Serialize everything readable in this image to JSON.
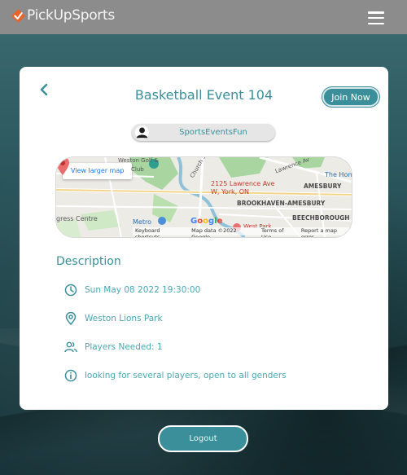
{
  "nav": {
    "brand": "PickUpSports",
    "menu_icon": "hamburger-menu-icon"
  },
  "event": {
    "title": "Basketball Event 104",
    "join_label": "Join Now",
    "host": "SportsEventsFun"
  },
  "map": {
    "view_larger": "View larger map",
    "address": "2125 Lawrence Ave W, York, ON",
    "labels": {
      "weston_golf": "Weston Golf &",
      "club": "Club",
      "church": "Church St",
      "lawrence": "Lawrence Av",
      "the_hom": "The Hom",
      "amesbury": "AMESBURY",
      "brookhaven": "BROOKHAVEN-AMESBURY",
      "beechborough": "BEECHBOROUGH",
      "metro": "Metro",
      "west_park": "West Park",
      "ogress": "gress Centre"
    },
    "google": [
      "G",
      "o",
      "o",
      "g",
      "l",
      "e"
    ],
    "footer": [
      "Keyboard shortcuts",
      "Map data ©2022 Google",
      "Terms of Use",
      "Report a map error"
    ]
  },
  "description": {
    "heading": "Description",
    "datetime": "Sun May 08 2022 19:30:00",
    "location": "Weston Lions Park",
    "players": "Players Needed: 1",
    "info": "looking for several players, open to all genders"
  },
  "logout_label": "Logout",
  "colors": {
    "accent": "#3a8f9a",
    "accent_light": "#4aa7b2",
    "topbar": "#8c8c8c",
    "brand_orange": "#e8632b"
  }
}
